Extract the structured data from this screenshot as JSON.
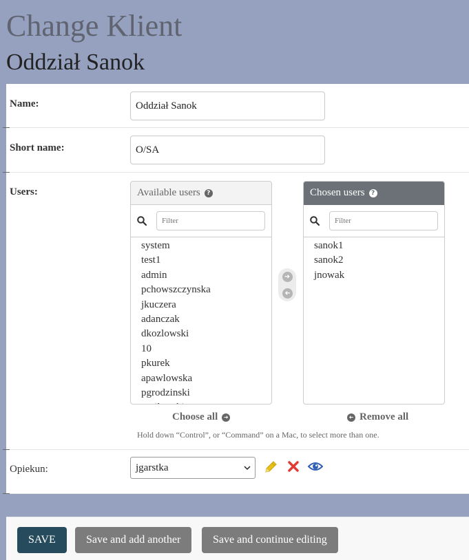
{
  "header": {
    "title": "Change Klient",
    "object_name": "Oddział Sanok"
  },
  "fields": {
    "name": {
      "label": "Name:",
      "value": "Oddział Sanok"
    },
    "short_name": {
      "label": "Short name:",
      "value": "O/SA"
    },
    "users": {
      "label": "Users:",
      "available": {
        "title": "Available users",
        "filter_placeholder": "Filter",
        "items": [
          "system",
          "test1",
          "admin",
          "pchowszczynska",
          "jkuczera",
          "adanczak",
          "dkozlowski",
          "10",
          "pkurek",
          "apawlowska",
          "pgrodzinski",
          "pmilewski"
        ]
      },
      "chosen": {
        "title": "Chosen users",
        "filter_placeholder": "Filter",
        "items": [
          "sanok1",
          "sanok2",
          "jnowak"
        ]
      },
      "choose_all": "Choose all",
      "remove_all": "Remove all",
      "help": "Hold down “Control”, or “Command” on a Mac, to select more than one."
    },
    "opiekun": {
      "label": "Opiekun:",
      "selected": "jgarstka"
    }
  },
  "icons": {
    "help": "question-circle-icon",
    "search": "search-icon",
    "add": "arrow-right-circle-icon",
    "remove": "arrow-left-circle-icon",
    "edit": "pencil-icon",
    "delete": "x-icon",
    "view": "eye-icon"
  },
  "colors": {
    "page_bg": "#95a1bf",
    "primary_button": "#264b5d",
    "secondary_button": "#7c7c7c",
    "chosen_header": "#6b7177",
    "edit_icon": "#e8c21a",
    "delete_icon": "#e23b30",
    "view_icon": "#2f5fb3"
  },
  "buttons": {
    "save": "SAVE",
    "save_add": "Save and add another",
    "save_continue": "Save and continue editing"
  }
}
